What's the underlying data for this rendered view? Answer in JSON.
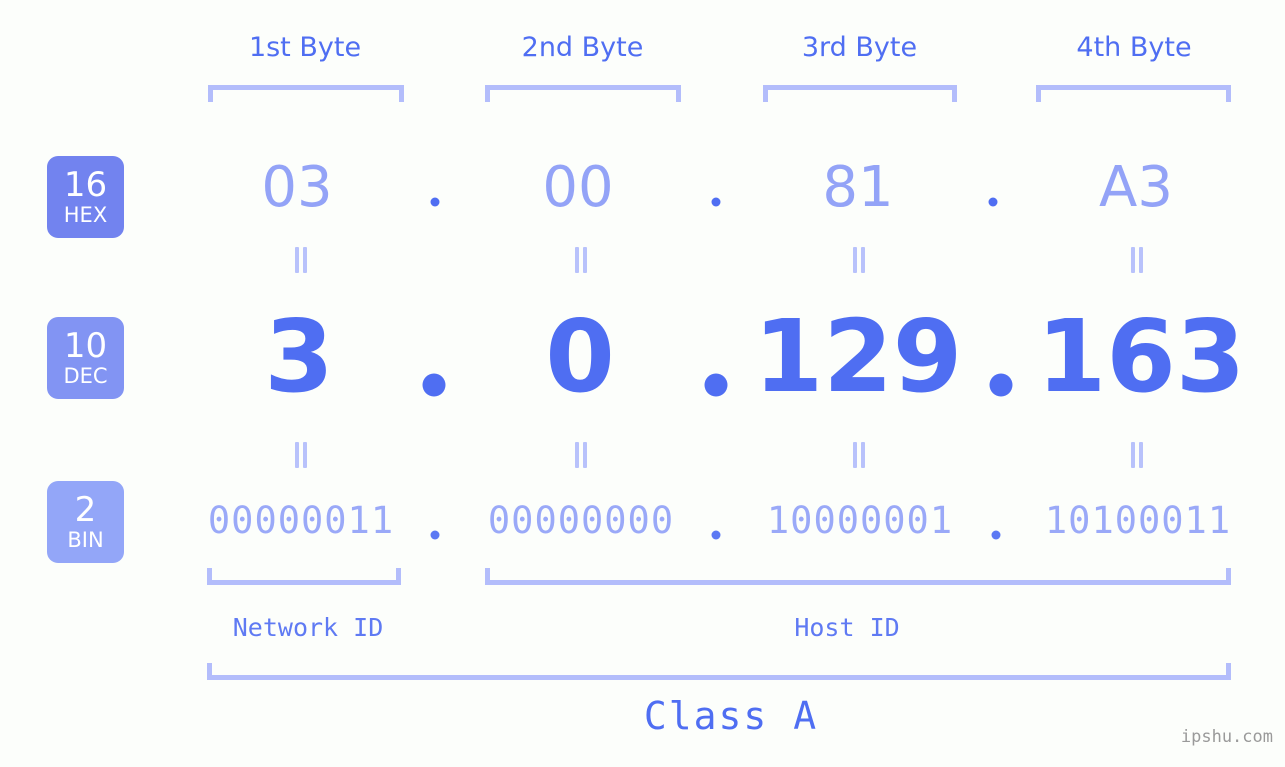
{
  "page": {
    "background_color": "#fcfefb",
    "accent_color": "#4f6ef2",
    "muted_accent_color": "#b3bdfb",
    "watermark": "ipshu.com"
  },
  "byte_headers": [
    {
      "label": "1st Byte"
    },
    {
      "label": "2nd Byte"
    },
    {
      "label": "3rd Byte"
    },
    {
      "label": "4th Byte"
    }
  ],
  "bases": [
    {
      "number": "16",
      "name": "HEX",
      "color": "#7283ef"
    },
    {
      "number": "10",
      "name": "DEC",
      "color": "#8294f3"
    },
    {
      "number": "2",
      "name": "BIN",
      "color": "#93a6f8"
    }
  ],
  "rows": {
    "hex": {
      "values": [
        "03",
        "00",
        "81",
        "A3"
      ],
      "separator": "."
    },
    "dec": {
      "values": [
        "3",
        "0",
        "129",
        "163"
      ],
      "separator": "."
    },
    "bin": {
      "values": [
        "00000011",
        "00000000",
        "10000001",
        "10100011"
      ],
      "separator": "."
    }
  },
  "equals_marks": {
    "symbol": "=",
    "rows": 2,
    "columns": 4
  },
  "sections": [
    {
      "label": "Network ID"
    },
    {
      "label": "Host ID"
    }
  ],
  "class": {
    "label": "Class A"
  },
  "ip_address": {
    "hex": "03.00.81.A3",
    "decimal": "3.0.129.163",
    "binary": "00000011.00000000.10000001.10100011"
  }
}
